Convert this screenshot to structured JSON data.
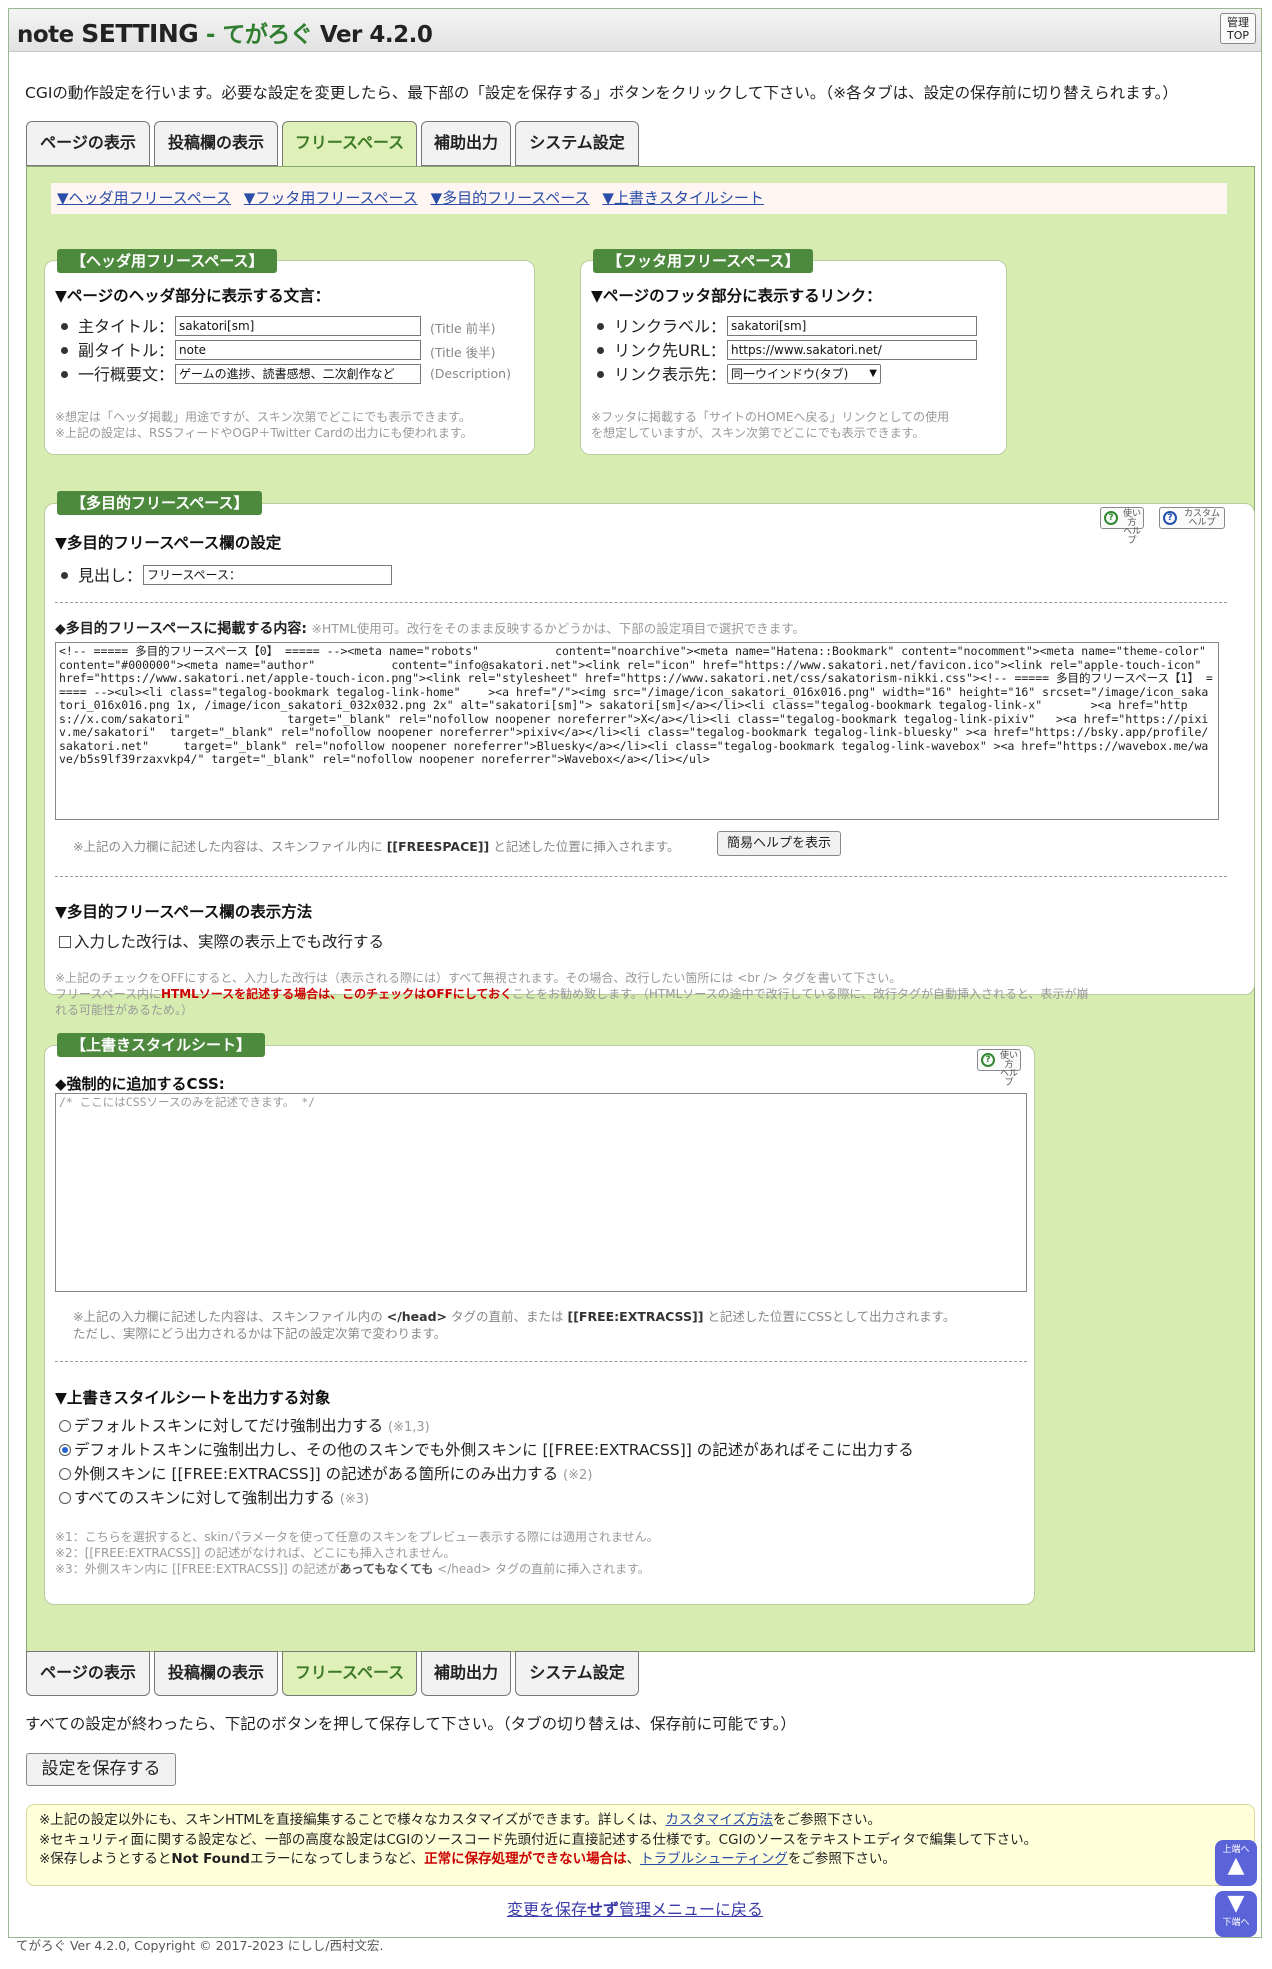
{
  "title": {
    "app": "note",
    "setting": "SETTING",
    "dash": "-",
    "product": "てがろぐ",
    "version": "Ver 4.2.0",
    "admin_top_line1": "管理",
    "admin_top_line2": "TOP"
  },
  "intro_text": "CGIの動作設定を行います。必要な設定を変更したら、最下部の「設定を保存する」ボタンをクリックして下さい。（※各タブは、設定の保存前に切り替えられます。）",
  "tabs": [
    "ページの表示",
    "投稿欄の表示",
    "フリースペース",
    "補助出力",
    "システム設定"
  ],
  "active_tab": "フリースペース",
  "anchors": [
    "▼ヘッダ用フリースペース",
    "▼フッタ用フリースペース",
    "▼多目的フリースペース",
    "▼上書きスタイルシート"
  ],
  "header_box": {
    "label": "【ヘッダ用フリースペース】",
    "heading": "▼ページのヘッダ部分に表示する文言：",
    "fields": [
      {
        "label": "主タイトル：",
        "value": "sakatori[sm]",
        "hint": "(Title 前半)"
      },
      {
        "label": "副タイトル：",
        "value": "note",
        "hint": "(Title 後半)"
      },
      {
        "label": "一行概要文：",
        "value": "ゲームの進捗、読書感想、二次創作など",
        "hint": "(Description)"
      }
    ],
    "note1": "※想定は「ヘッダ掲載」用途ですが、スキン次第でどこにでも表示できます。",
    "note2": "※上記の設定は、RSSフィードやOGP＋Twitter Cardの出力にも使われます。"
  },
  "footer_box": {
    "label": "【フッタ用フリースペース】",
    "heading": "▼ページのフッタ部分に表示するリンク：",
    "fields": [
      {
        "label": "リンクラベル：",
        "value": "sakatori[sm]"
      },
      {
        "label": "リンク先URL：",
        "value": "https://www.sakatori.net/"
      },
      {
        "label": "リンク表示先：",
        "value": "同一ウインドウ(タブ)"
      }
    ],
    "note1": "※フッタに掲載する「サイトのHOMEへ戻る」リンクとしての使用",
    "note2": "を想定していますが、スキン次第でどこにでも表示できます。"
  },
  "multi_box": {
    "label": "【多目的フリースペース】",
    "help1": [
      "使い方",
      "ヘルプ"
    ],
    "help2": [
      "カスタム",
      "ヘルプ"
    ],
    "heading1": "▼多目的フリースペース欄の設定",
    "midashi_label": "見出し：",
    "midashi_value": "フリースペース：",
    "content_heading": "◆多目的フリースペースに掲載する内容:",
    "content_hint": "※HTML使用可。改行をそのまま反映するかどうかは、下部の設定項目で選択できます。",
    "content": "<!-- ===== 多目的フリースペース【0】 ===== --><meta name=\"robots\"           content=\"noarchive\"><meta name=\"Hatena::Bookmark\" content=\"nocomment\"><meta name=\"theme-color\"      content=\"#000000\"><meta name=\"author\"           content=\"info@sakatori.net\"><link rel=\"icon\" href=\"https://www.sakatori.net/favicon.ico\"><link rel=\"apple-touch-icon\"  href=\"https://www.sakatori.net/apple-touch-icon.png\"><link rel=\"stylesheet\" href=\"https://www.sakatori.net/css/sakatorism-nikki.css\"><!-- ===== 多目的フリースペース【1】 ===== --><ul><li class=\"tegalog-bookmark tegalog-link-home\"    ><a href=\"/\"><img src=\"/image/icon_sakatori_016x016.png\" width=\"16\" height=\"16\" srcset=\"/image/icon_sakatori_016x016.png 1x, /image/icon_sakatori_032x032.png 2x\" alt=\"sakatori[sm]\"> sakatori[sm]</a></li><li class=\"tegalog-bookmark tegalog-link-x\"       ><a href=\"https://x.com/sakatori\"              target=\"_blank\" rel=\"nofollow noopener noreferrer\">X</a></li><li class=\"tegalog-bookmark tegalog-link-pixiv\"   ><a href=\"https://pixiv.me/sakatori\"  target=\"_blank\" rel=\"nofollow noopener noreferrer\">pixiv</a></li><li class=\"tegalog-bookmark tegalog-link-bluesky\" ><a href=\"https://bsky.app/profile/sakatori.net\"     target=\"_blank\" rel=\"nofollow noopener noreferrer\">Bluesky</a></li><li class=\"tegalog-bookmark tegalog-link-wavebox\" ><a href=\"https://wavebox.me/wave/b5s9lf39rzaxvkp4/\" target=\"_blank\" rel=\"nofollow noopener noreferrer\">Wavebox</a></li></ul>",
    "insert_note_pre": "※上記の入力欄に記述した内容は、スキンファイル内に",
    "insert_note_tag": "[[FREESPACE]]",
    "insert_note_post": "と記述した位置に挿入されます。",
    "easy_help_button": "簡易ヘルプを表示",
    "heading2": "▼多目的フリースペース欄の表示方法",
    "checkbox_label": "入力した改行は、実際の表示上でも改行する",
    "note1": "※上記のチェックをOFFにすると、入力した改行は（表示される際には）すべて無視されます。その場合、改行したい箇所には <br /> タグを書いて下さい。",
    "note2_pre": "フリースペース内に",
    "note2_red": "HTMLソースを記述する場合は、このチェックはOFFにしておく",
    "note2_post": "ことをお勧め致します。（HTMLソースの途中で改行している際に、改行タグが自動挿入されると、表示が崩",
    "note3": "れる可能性があるため。）"
  },
  "css_box": {
    "label": "【上書きスタイルシート】",
    "help1": [
      "使い方",
      "ヘルプ"
    ],
    "heading": "◆強制的に追加するCSS:",
    "placeholder": "/* ここにはCSSソースのみを記述できます。 */",
    "note1_pre": "※上記の入力欄に記述した内容は、スキンファイル内の",
    "note1_tag1": "</head>",
    "note1_mid": "タグの直前、または",
    "note1_tag2": "[[FREE:EXTRACSS]]",
    "note1_post": "と記述した位置にCSSとして出力されます。",
    "note2": "ただし、実際にどう出力されるかは下記の設定次第で変わります。",
    "heading2": "▼上書きスタイルシートを出力する対象",
    "options": [
      {
        "label": "デフォルトスキンに対してだけ強制出力する",
        "hint": "(※1,3)"
      },
      {
        "label": "デフォルトスキンに強制出力し、その他のスキンでも外側スキンに [[FREE:EXTRACSS]] の記述があればそこに出力する",
        "hint": ""
      },
      {
        "label": "外側スキンに [[FREE:EXTRACSS]] の記述がある箇所にのみ出力する",
        "hint": "(※2)"
      },
      {
        "label": "すべてのスキンに対して強制出力する",
        "hint": "(※3)"
      }
    ],
    "selected_option": 1,
    "fn1": "※1：こちらを選択すると、skinパラメータを使って任意のスキンをプレビュー表示する際には適用されません。",
    "fn2": "※2：[[FREE:EXTRACSS]] の記述がなければ、どこにも挿入されません。",
    "fn3_pre": "※3：外側スキン内に [[FREE:EXTRACSS]] の記述が",
    "fn3_bold": "あってもなくても",
    "fn3_post": " </head> タグの直前に挿入されます。"
  },
  "bottom_text": "すべての設定が終わったら、下記のボタンを押して保存して下さい。（タブの切り替えは、保存前に可能です。）",
  "save_button": "設定を保存する",
  "info": {
    "l1_pre": "※上記の設定以外にも、スキンHTMLを直接編集することで様々なカスタマイズができます。詳しくは、",
    "l1_link": "カスタマイズ方法",
    "l1_post": "をご参照下さい。",
    "l2": "※セキュリティ面に関する設定など、一部の高度な設定はCGIのソースコード先頭付近に直接記述する仕様です。CGIのソースをテキストエディタで編集して下さい。",
    "l3_pre": "※保存しようとすると",
    "l3_bold": "Not Found",
    "l3_mid": "エラーになってしまうなど、",
    "l3_red": "正常に保存処理ができない場合は",
    "l3_mid2": "、",
    "l3_link": "トラブルシューティング",
    "l3_post": "をご参照下さい。"
  },
  "back_link": {
    "pre": "変更を保存",
    "bold": "せず",
    "post": "管理メニューに戻る"
  },
  "footer": "てがろぐ Ver 4.2.0, Copyright © 2017-2023 にしし/西村文宏.",
  "scroll": {
    "up": "上端へ",
    "down": "下端へ"
  },
  "colors": {
    "panel_bg": "#d7ecb0",
    "label_bg": "#4e8a3e",
    "active_tab_text": "#3d7a26",
    "link": "#2a4ea8",
    "red": "#cc0000",
    "info_bg": "#ffffd9"
  }
}
